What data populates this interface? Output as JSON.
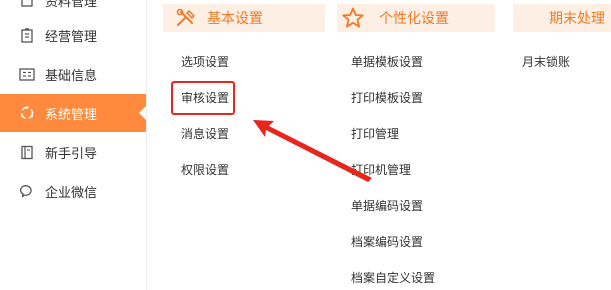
{
  "sidebar": {
    "items": [
      {
        "label": "经营管理",
        "icon": "clipboard-icon"
      },
      {
        "label": "基础信息",
        "icon": "id-card-icon"
      },
      {
        "label": "系统管理",
        "icon": "cycle-icon"
      },
      {
        "label": "新手引导",
        "icon": "book-icon"
      },
      {
        "label": "企业微信",
        "icon": "chat-icon"
      }
    ],
    "top_partial": "资料管理"
  },
  "sections": {
    "basic": {
      "title": "基本设置",
      "icon": "tools-icon",
      "links": [
        "选项设置",
        "审核设置",
        "消息设置",
        "权限设置"
      ]
    },
    "personal": {
      "title": "个性化设置",
      "icon": "star-icon",
      "links": [
        "单据模板设置",
        "打印模板设置",
        "打印管理",
        "打印机管理",
        "单据编码设置",
        "档案编码设置",
        "档案自定义设置"
      ]
    },
    "period_end": {
      "title": "期末处理",
      "links": [
        "月末锁账"
      ]
    }
  },
  "colors": {
    "accent": "#ff8a3d",
    "header_bg": "#fdefe4",
    "header_text": "#f07a25",
    "annotation": "#e8261d"
  }
}
